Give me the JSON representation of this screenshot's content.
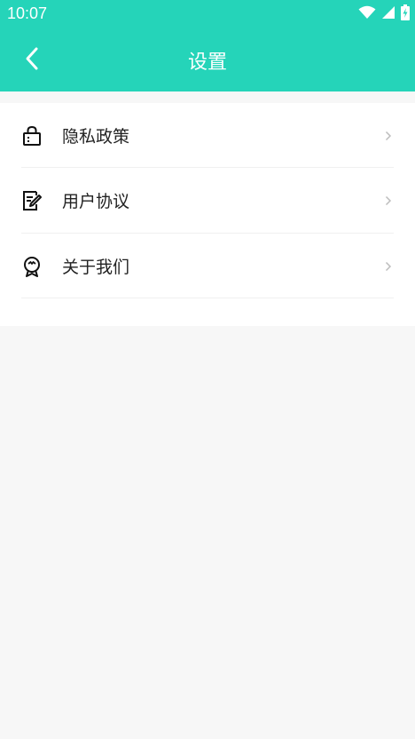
{
  "status_bar": {
    "time": "10:07",
    "icons": [
      "wifi-icon",
      "signal-icon",
      "battery-charging-icon"
    ]
  },
  "header": {
    "title": "设置",
    "back_icon": "chevron-left-icon"
  },
  "colors": {
    "accent": "#25d4b9",
    "background": "#f7f7f7",
    "card": "#ffffff",
    "text": "#222222"
  },
  "settings": {
    "items": [
      {
        "label": "隐私政策",
        "icon": "lock-icon"
      },
      {
        "label": "用户协议",
        "icon": "document-edit-icon"
      },
      {
        "label": "关于我们",
        "icon": "ribbon-badge-icon"
      }
    ],
    "chevron_icon": "chevron-right-icon"
  }
}
